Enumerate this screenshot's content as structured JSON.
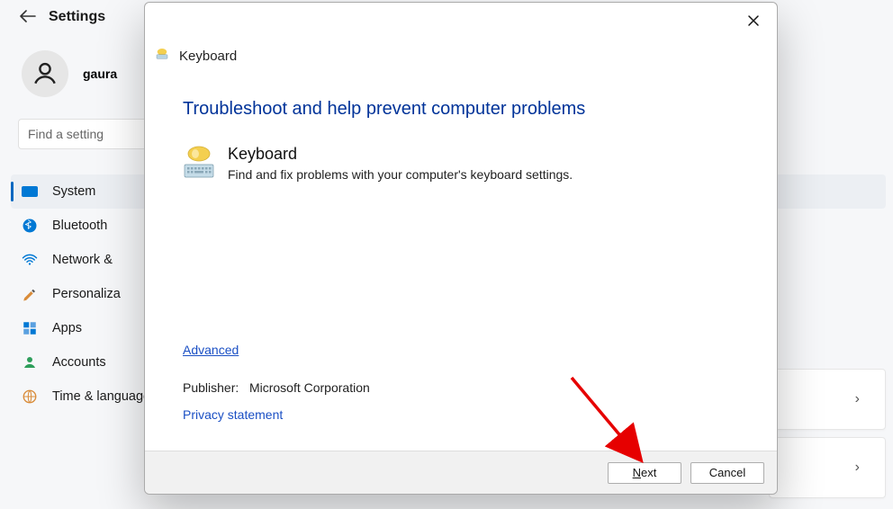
{
  "settings": {
    "title": "Settings",
    "profile_name": "gaura",
    "search_placeholder": "Find a setting",
    "nav": [
      {
        "label": "System",
        "icon": "display-icon",
        "selected": true
      },
      {
        "label": "Bluetooth",
        "icon": "bluetooth-icon",
        "selected": false
      },
      {
        "label": "Network &",
        "icon": "wifi-icon",
        "selected": false
      },
      {
        "label": "Personaliza",
        "icon": "brush-icon",
        "selected": false
      },
      {
        "label": "Apps",
        "icon": "apps-icon",
        "selected": false
      },
      {
        "label": "Accounts",
        "icon": "account-icon",
        "selected": false
      },
      {
        "label": "Time & language",
        "icon": "globe-icon",
        "selected": false
      }
    ]
  },
  "modal": {
    "window_title": "Keyboard",
    "headline": "Troubleshoot and help prevent computer problems",
    "section_title": "Keyboard",
    "section_desc": "Find and fix problems with your computer's keyboard settings.",
    "advanced_label": "Advanced",
    "publisher_label": "Publisher:",
    "publisher_value": "Microsoft Corporation",
    "privacy_label": "Privacy statement",
    "next_label": "ext",
    "next_prefix": "N",
    "cancel_label": "Cancel"
  }
}
